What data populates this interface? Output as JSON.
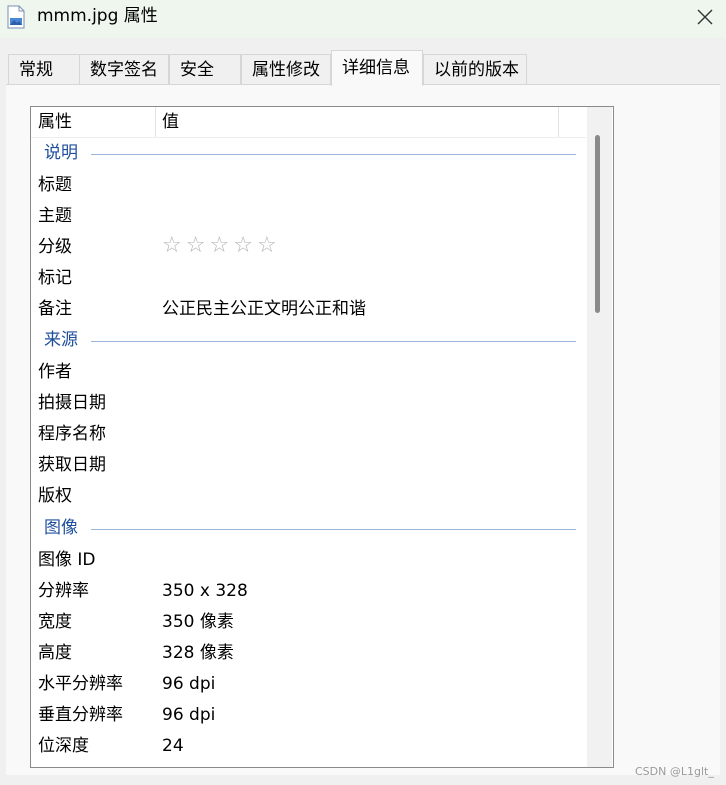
{
  "window": {
    "title": "mmm.jpg 属性",
    "file_icon": "image-file-icon",
    "close_icon": "close-icon"
  },
  "tabs": [
    {
      "label": "常规",
      "active": false
    },
    {
      "label": "数字签名",
      "active": false
    },
    {
      "label": "安全",
      "active": false
    },
    {
      "label": "属性修改",
      "active": false
    },
    {
      "label": "详细信息",
      "active": true
    },
    {
      "label": "以前的版本",
      "active": false
    }
  ],
  "details": {
    "header": {
      "property": "属性",
      "value": "值"
    },
    "groups": {
      "description": {
        "label": "说明",
        "rows": {
          "title": {
            "name": "标题",
            "value": ""
          },
          "subject": {
            "name": "主题",
            "value": ""
          },
          "rating": {
            "name": "分级",
            "value": "",
            "stars": 0,
            "max_stars": 5
          },
          "tags": {
            "name": "标记",
            "value": ""
          },
          "comments": {
            "name": "备注",
            "value": "公正民主公正文明公正和谐"
          }
        }
      },
      "origin": {
        "label": "来源",
        "rows": {
          "author": {
            "name": "作者",
            "value": ""
          },
          "date_taken": {
            "name": "拍摄日期",
            "value": ""
          },
          "program_name": {
            "name": "程序名称",
            "value": ""
          },
          "date_acquired": {
            "name": "获取日期",
            "value": ""
          },
          "copyright": {
            "name": "版权",
            "value": ""
          }
        }
      },
      "image": {
        "label": "图像",
        "rows": {
          "image_id": {
            "name": "图像 ID",
            "value": ""
          },
          "dimensions": {
            "name": "分辨率",
            "value": "350 x 328"
          },
          "width": {
            "name": "宽度",
            "value": "350 像素"
          },
          "height": {
            "name": "高度",
            "value": "328 像素"
          },
          "h_resolution": {
            "name": "水平分辨率",
            "value": "96 dpi"
          },
          "v_resolution": {
            "name": "垂直分辨率",
            "value": "96 dpi"
          },
          "bit_depth": {
            "name": "位深度",
            "value": "24"
          }
        }
      }
    }
  },
  "watermark": "CSDN @L1glt_"
}
